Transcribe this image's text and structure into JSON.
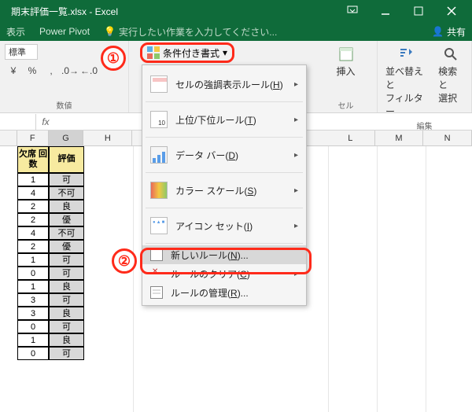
{
  "titlebar": {
    "title": "期末評価一覧.xlsx - Excel"
  },
  "tabs": {
    "view": "表示",
    "powerpivot": "Power Pivot",
    "tellme": "実行したい作業を入力してください...",
    "share": "共有"
  },
  "ribbon": {
    "number_style": "標準",
    "group_number": "数値",
    "cf_label": "条件付き書式",
    "insert": "挿入",
    "group_cells": "セル",
    "sort": "並べ替えと\nフィルター",
    "find": "検索と\n選択",
    "group_editing": "編集"
  },
  "dropdown": {
    "highlight": "セルの強調表示ルール",
    "highlight_accel": "H",
    "top": "上位/下位ルール",
    "top_accel": "T",
    "databar": "データ バー",
    "databar_accel": "D",
    "colorscale": "カラー スケール",
    "colorscale_accel": "S",
    "iconset": "アイコン セット",
    "iconset_accel": "I",
    "newrule": "新しいルール",
    "newrule_accel": "N",
    "clear": "ルールのクリア",
    "clear_accel": "C",
    "manage": "ルールの管理",
    "manage_accel": "R"
  },
  "annotations": {
    "one": "①",
    "two": "②"
  },
  "columns": [
    "F",
    "G",
    "H",
    "L",
    "M",
    "N"
  ],
  "headers": {
    "f": "欠席\n回数",
    "g": "評価"
  },
  "data_rows": [
    {
      "f": "1",
      "g": "可"
    },
    {
      "f": "4",
      "g": "不可"
    },
    {
      "f": "2",
      "g": "良"
    },
    {
      "f": "2",
      "g": "優"
    },
    {
      "f": "4",
      "g": "不可"
    },
    {
      "f": "2",
      "g": "優"
    },
    {
      "f": "1",
      "g": "可"
    },
    {
      "f": "0",
      "g": "可"
    },
    {
      "f": "1",
      "g": "良"
    },
    {
      "f": "3",
      "g": "可"
    },
    {
      "f": "3",
      "g": "良"
    },
    {
      "f": "0",
      "g": "可"
    },
    {
      "f": "1",
      "g": "良"
    },
    {
      "f": "0",
      "g": "可"
    }
  ]
}
